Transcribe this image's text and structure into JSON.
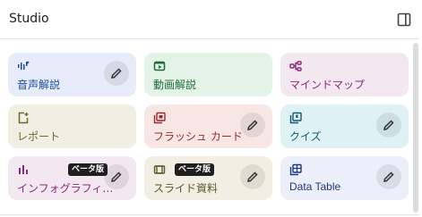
{
  "header": {
    "title": "Studio"
  },
  "tiles": [
    {
      "label": "音声解説",
      "color": "#1a4d99",
      "bg": "#e8ecfa",
      "icon": "audio-waveform-icon"
    },
    {
      "label": "動画解説",
      "color": "#1e6b3a",
      "bg": "#e4f3e8",
      "icon": "video-icon"
    },
    {
      "label": "マインドマップ",
      "color": "#8a2a7a",
      "bg": "#f3e7f0",
      "icon": "mind-map-icon"
    },
    {
      "label": "レポート",
      "color": "#6b6b2a",
      "bg": "#f1efe3",
      "icon": "report-icon"
    },
    {
      "label": "フラッシュ カード",
      "color": "#9a2a2a",
      "bg": "#f8e6e4",
      "icon": "flashcards-icon"
    },
    {
      "label": "クイズ",
      "color": "#0f5a6e",
      "bg": "#def1f5",
      "icon": "quiz-icon"
    },
    {
      "label": "インフォグラフィ…",
      "color": "#8a2a7a",
      "bg": "#f3e7f0",
      "icon": "infographic-icon",
      "badge": "ベータ版"
    },
    {
      "label": "スライド資料",
      "color": "#5a5a2a",
      "bg": "#f1efe3",
      "icon": "slides-icon",
      "badge": "ベータ版"
    },
    {
      "label": "Data Table",
      "color": "#1a3a7a",
      "bg": "#eceffa",
      "icon": "data-table-icon"
    }
  ]
}
